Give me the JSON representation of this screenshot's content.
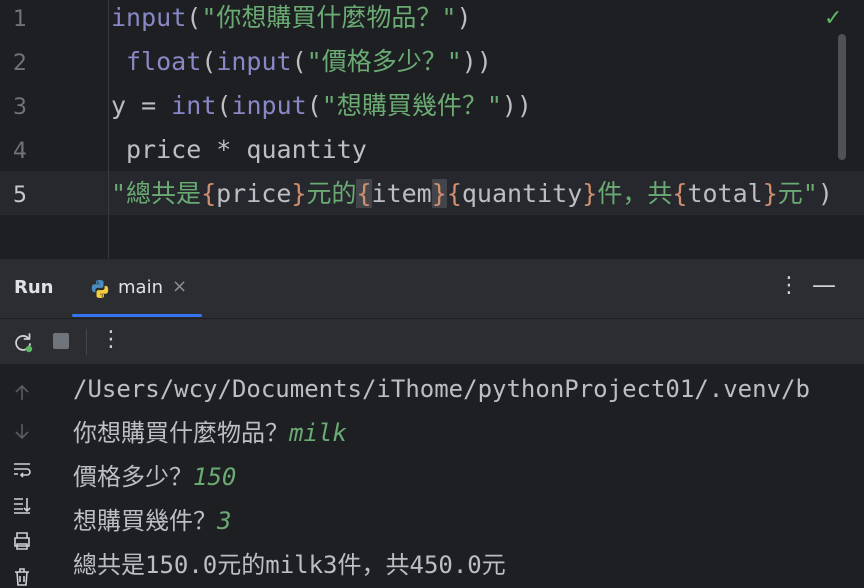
{
  "editor": {
    "line_numbers": [
      "1",
      "2",
      "3",
      "4",
      "5"
    ],
    "lines": [
      {
        "fn": "input",
        "open": "(",
        "str": "\"你想購買什麼物品？\"",
        "close": ")"
      },
      {
        "outer": "float",
        "open1": "(",
        "inner": "input",
        "open2": "(",
        "str": "\"價格多少？\"",
        "close": "))"
      },
      {
        "lhs": "y = ",
        "outer": "int",
        "open1": "(",
        "inner": "input",
        "open2": "(",
        "str": "\"想購買幾件？\"",
        "close": "))"
      },
      {
        "text": "price * quantity"
      },
      {
        "s1": "\"總共是",
        "b1o": "{",
        "v1": "price",
        "b1c": "}",
        "s2": "元的",
        "b2o": "{",
        "v2": "item",
        "b2c": "}",
        "b3o": "{",
        "v3": "quantity",
        "b3c": "}",
        "s3": "件，共",
        "b4o": "{",
        "v4": "total",
        "b4c": "}",
        "s4": "元\"",
        "tail": ")"
      }
    ],
    "status_icon": "checkmark-icon"
  },
  "run": {
    "title": "Run",
    "tab_label": "main",
    "tab_icon": "python-icon",
    "more": "⋮",
    "minimize": "—",
    "toolbar_more": "⋮"
  },
  "console": {
    "path": "/Users/wcy/Documents/iThome/pythonProject01/.venv/b",
    "prompts": [
      {
        "prompt": "你想購買什麼物品？",
        "input": "milk"
      },
      {
        "prompt": "價格多少？",
        "input": "150"
      },
      {
        "prompt": "想購買幾件？",
        "input": "3"
      }
    ],
    "result": "總共是150.0元的milk3件，共450.0元"
  },
  "colors": {
    "accent": "#3574f0",
    "string": "#6aab73",
    "function": "#56a8f5",
    "builtin": "#8888c6",
    "brace": "#cf8e6d"
  }
}
